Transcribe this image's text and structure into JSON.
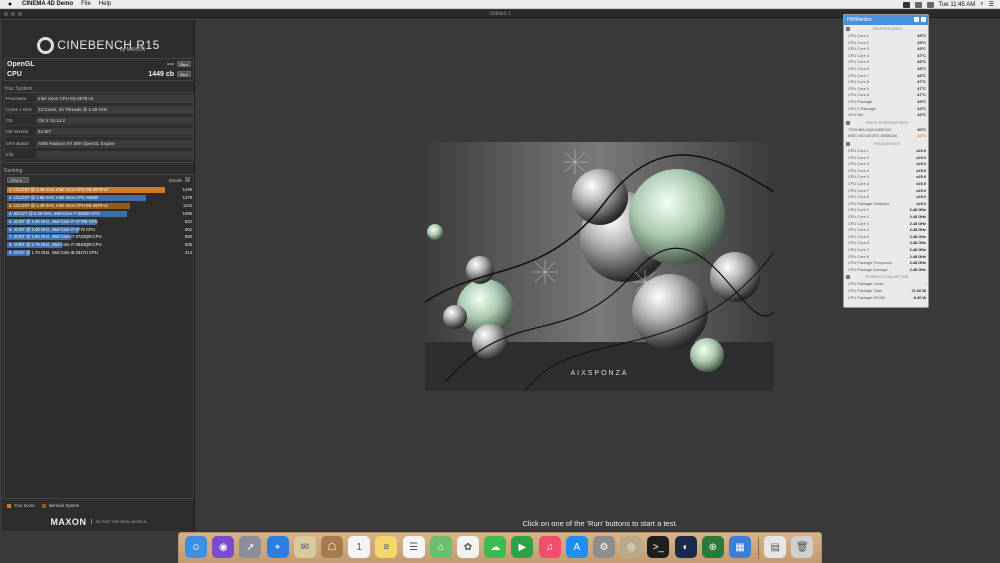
{
  "menubar": {
    "app": "CINEMA 4D Demo",
    "items": [
      "File",
      "Help"
    ],
    "clock": "Tue 11:45 AM"
  },
  "window": {
    "title": "Untitled 1"
  },
  "logo": {
    "name": "CINEBENCH R15",
    "sub": "by MAXON"
  },
  "scores": {
    "opengl_label": "OpenGL",
    "opengl_value": "---",
    "cpu_label": "CPU",
    "cpu_value": "1449 cb",
    "run_label": "Run"
  },
  "system": {
    "header": "Your System",
    "rows": [
      {
        "k": "Processor",
        "v": "Intel Xeon CPU E5-2678 v3"
      },
      {
        "k": "Cores x GHz",
        "v": "12 Cores, 24 Threads @ 2.49 GHz"
      },
      {
        "k": "OS",
        "v": "OS X 10.14.2"
      },
      {
        "k": "CB Version",
        "v": "64 BIT"
      },
      {
        "k": "GFX Board",
        "v": "AMD Radeon RX 580 OpenGL Engine"
      },
      {
        "k": "Info",
        "v": ""
      }
    ]
  },
  "ranking": {
    "header": "Ranking",
    "dropdown": "CPU",
    "details_label": "Details",
    "rows": [
      {
        "label": "1. 12C/24T @ 2.49 GHz, Intel Xeon CPU E5-2678 v3",
        "score": 1449,
        "kind": "your"
      },
      {
        "label": "2. 12C/24T @ 2.66 GHz, Intel Xeon CPU X5650",
        "score": 1279,
        "kind": "other"
      },
      {
        "label": "3. 12C/24T @ 2.49 GHz, Intel Xeon CPU E5-2678 v3",
        "score": 1124,
        "kind": "identical"
      },
      {
        "label": "4. 6C/12T @ 3.30 GHz,  Intel Core i7-3930K CPU",
        "score": 1096,
        "kind": "other"
      },
      {
        "label": "5. 4C/8T @ 4.40 GHz,  Intel Core i7-4770K CPU",
        "score": 822,
        "kind": "other"
      },
      {
        "label": "6. 4C/8T @ 3.40 GHz,  Intel Core i7-3770 CPU",
        "score": 662,
        "kind": "other"
      },
      {
        "label": "7. 4C/8T @ 2.60 GHz,  Intel Core i7-3720QM CPU",
        "score": 590,
        "kind": "other"
      },
      {
        "label": "8. 4C/8T @ 2.79 GHz,  Intel Core i7-3840QM CPU",
        "score": 505,
        "kind": "other"
      },
      {
        "label": "9. 2C/4T @ 1.70 GHz,  Intel Core i5-3317U CPU",
        "score": 214,
        "kind": "other"
      }
    ],
    "max_score": 1449,
    "legend_your": "Your Score",
    "legend_identical": "Identical System",
    "colors": {
      "your": "#d4771f",
      "identical": "#9a5a17",
      "other": "#3f6fa8"
    }
  },
  "maxon": {
    "brand": "MAXON",
    "tagline": "3D FOR THE REAL WORLD"
  },
  "render": {
    "watermark": "AIXSPONZA"
  },
  "status": "Click on one of the 'Run' buttons to start a test.",
  "hwmonitor": {
    "title": "HWMonitor",
    "sections": [
      {
        "title": "TEMPERATURES",
        "rows": [
          {
            "n": "CPU Core 1",
            "v": "49°C"
          },
          {
            "n": "CPU Core 2",
            "v": "45°C"
          },
          {
            "n": "CPU Core 3",
            "v": "49°C"
          },
          {
            "n": "CPU Core 4",
            "v": "47°C"
          },
          {
            "n": "CPU Core 5",
            "v": "46°C"
          },
          {
            "n": "CPU Core 6",
            "v": "45°C"
          },
          {
            "n": "CPU Core 7",
            "v": "46°C"
          },
          {
            "n": "CPU Core 8",
            "v": "47°C"
          },
          {
            "n": "CPU Core 9",
            "v": "47°C"
          },
          {
            "n": "CPU Core A",
            "v": "47°C"
          },
          {
            "n": "CPU Package",
            "v": "49°C"
          },
          {
            "n": "CPU 2 Package",
            "v": "44°C"
          },
          {
            "n": "GPU Die",
            "v": "42°C"
          }
        ]
      },
      {
        "title": "DRIVE TEMPERATURES",
        "rows": [
          {
            "n": "TOSHIBA MQ01ABD100",
            "v": "30°C",
            "warn": false
          },
          {
            "n": "WDC WD10EZEX-00BN5A0",
            "v": "42°C",
            "warn": true
          }
        ]
      },
      {
        "title": "FREQUENCIES",
        "rows": [
          {
            "n": "CPU Core 1",
            "v": "x25.0"
          },
          {
            "n": "CPU Core 2",
            "v": "x25.0"
          },
          {
            "n": "CPU Core 3",
            "v": "x25.0"
          },
          {
            "n": "CPU Core 4",
            "v": "x25.0"
          },
          {
            "n": "CPU Core 5",
            "v": "x25.0"
          },
          {
            "n": "CPU Core 6",
            "v": "x25.0"
          },
          {
            "n": "CPU Core 7",
            "v": "x25.0"
          },
          {
            "n": "CPU Core 8",
            "v": "x25.0"
          },
          {
            "n": "CPU Package Multiplier",
            "v": "x25.0"
          },
          {
            "n": "CPU Core 1",
            "v": "2.48 GHz"
          },
          {
            "n": "CPU Core 2",
            "v": "2.48 GHz"
          },
          {
            "n": "CPU Core 3",
            "v": "2.48 GHz"
          },
          {
            "n": "CPU Core 4",
            "v": "2.48 GHz"
          },
          {
            "n": "CPU Core 5",
            "v": "2.48 GHz"
          },
          {
            "n": "CPU Core 6",
            "v": "2.48 GHz"
          },
          {
            "n": "CPU Core 7",
            "v": "2.48 GHz"
          },
          {
            "n": "CPU Core 8",
            "v": "2.48 GHz"
          },
          {
            "n": "CPU Package Frequency",
            "v": "2.48 GHz"
          },
          {
            "n": "CPU Package Average",
            "v": "2.48 GHz"
          }
        ]
      },
      {
        "title": "POWER CONSUMPTION",
        "rows": [
          {
            "n": "CPU Package Cores",
            "v": "-"
          },
          {
            "n": "CPU Package Total",
            "v": "71.60 W"
          },
          {
            "n": "CPU Package DRAM",
            "v": "8.40 W"
          }
        ]
      }
    ]
  },
  "dock": {
    "items": [
      {
        "name": "finder",
        "color": "#3d8fe0",
        "glyph": "☺"
      },
      {
        "name": "siri",
        "color": "#7a4bd1",
        "glyph": "◉"
      },
      {
        "name": "launchpad",
        "color": "#8a8f99",
        "glyph": "➚"
      },
      {
        "name": "safari",
        "color": "#2c7fe0",
        "glyph": "⌖"
      },
      {
        "name": "mail",
        "color": "#d8c9a2",
        "glyph": "✉"
      },
      {
        "name": "contacts",
        "color": "#a57b4e",
        "glyph": "☖"
      },
      {
        "name": "calendar",
        "color": "#f4f4f4",
        "glyph": "1"
      },
      {
        "name": "notes",
        "color": "#f3d76a",
        "glyph": "≡"
      },
      {
        "name": "reminders",
        "color": "#f6f6f6",
        "glyph": "☰"
      },
      {
        "name": "maps",
        "color": "#6bbf6b",
        "glyph": "⌂"
      },
      {
        "name": "photos",
        "color": "#f2f2f2",
        "glyph": "✿"
      },
      {
        "name": "messages",
        "color": "#3dbb4e",
        "glyph": "☁"
      },
      {
        "name": "facetime",
        "color": "#2fa344",
        "glyph": "▶"
      },
      {
        "name": "music",
        "color": "#f04e6b",
        "glyph": "♫"
      },
      {
        "name": "app-store",
        "color": "#1f8ef2",
        "glyph": "A"
      },
      {
        "name": "system-preferences",
        "color": "#8e8e8e",
        "glyph": "⚙"
      },
      {
        "name": "disk-utility",
        "color": "#b8a98a",
        "glyph": "◎"
      },
      {
        "name": "terminal",
        "color": "#1e1e1e",
        "glyph": ">_"
      },
      {
        "name": "cinema-4d",
        "color": "#1b2a4a",
        "glyph": "◐"
      },
      {
        "name": "hwmonitor",
        "color": "#2a7a3a",
        "glyph": "⊕"
      },
      {
        "name": "utilities",
        "color": "#3c7fd6",
        "glyph": "▦"
      },
      {
        "name": "documents",
        "color": "#e6e6e6",
        "glyph": "▤"
      },
      {
        "name": "trash",
        "color": "#cfcfcf",
        "glyph": "🗑"
      }
    ]
  }
}
